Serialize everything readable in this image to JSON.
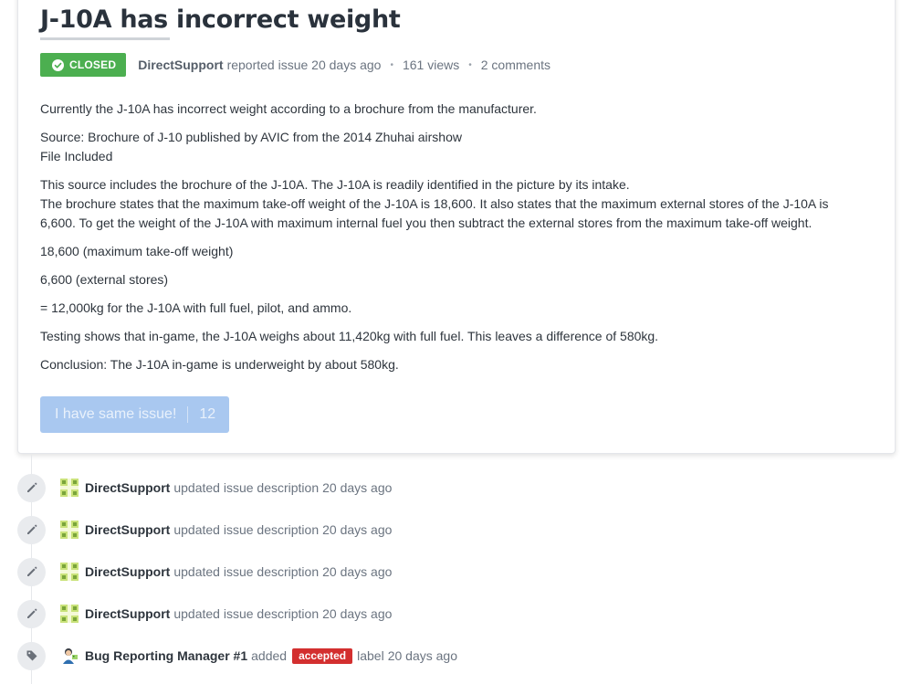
{
  "issue": {
    "title": "J-10A has incorrect weight",
    "status": "CLOSED",
    "author": "DirectSupport",
    "reported_text": "reported issue 20 days ago",
    "views": "161 views",
    "comments": "2 comments",
    "status_color": "#4caf50"
  },
  "body": {
    "p1": "Currently the J-10A has incorrect weight according to a brochure from the manufacturer.",
    "p2_line1": "Source: Brochure of J-10 published by AVIC from the 2014 Zhuhai airshow",
    "p2_line2": "File Included",
    "p3_line1": "This source includes the brochure of the J-10A. The J-10A is readily identified in the picture by its intake.",
    "p3_line2": "The brochure states that the maximum take-off weight of the J-10A is 18,600. It also states that the maximum external stores of the J-10A is 6,600. To get the weight of the J-10A with maximum internal fuel you then subtract the external stores from the maximum take-off weight.",
    "p4": "18,600 (maximum take-off weight)",
    "p5": "6,600 (external stores)",
    "p6": "= 12,000kg for the J-10A with full fuel, pilot, and ammo.",
    "p7": "Testing shows that in-game, the J-10A weighs about 11,420kg with full fuel. This leaves a difference of 580kg.",
    "p8": "Conclusion: The J-10A in-game is underweight by about 580kg."
  },
  "same_issue": {
    "label": "I have same issue!",
    "count": "12"
  },
  "timeline": [
    {
      "user": "DirectSupport",
      "action": "updated issue description",
      "time": "20 days ago",
      "icon": "pencil-icon"
    },
    {
      "user": "DirectSupport",
      "action": "updated issue description",
      "time": "20 days ago",
      "icon": "pencil-icon"
    },
    {
      "user": "DirectSupport",
      "action": "updated issue description",
      "time": "20 days ago",
      "icon": "pencil-icon"
    },
    {
      "user": "DirectSupport",
      "action": "updated issue description",
      "time": "20 days ago",
      "icon": "pencil-icon"
    },
    {
      "user": "Bug Reporting Manager #1",
      "action": "added",
      "label": "accepted",
      "suffix": "label",
      "time": "20 days ago",
      "icon": "tag-icon",
      "label_color": "#d32f2f"
    }
  ]
}
